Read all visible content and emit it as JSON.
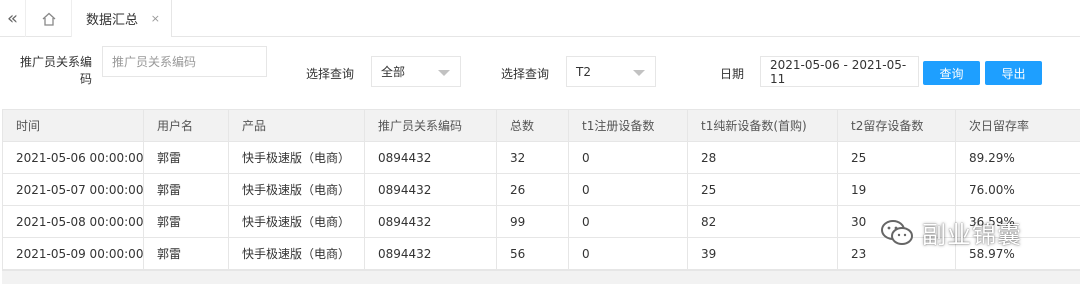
{
  "tabbar": {
    "collapse_glyph": "«",
    "home_icon": "home-icon",
    "active_tab": {
      "label": "数据汇总",
      "close": "×"
    }
  },
  "filters": {
    "relation_code": {
      "label": "推广员关系编码",
      "placeholder": "推广员关系编码",
      "value": ""
    },
    "query1": {
      "label": "选择查询",
      "selected": "全部"
    },
    "query2": {
      "label": "选择查询",
      "selected": "T2"
    },
    "date": {
      "label": "日期",
      "value": "2021-05-06 - 2021-05-11"
    },
    "buttons": {
      "search": "查询",
      "export": "导出"
    },
    "accent_color": "#1e9fff"
  },
  "table": {
    "columns": [
      "时间",
      "用户名",
      "产品",
      "推广员关系编码",
      "总数",
      "t1注册设备数",
      "t1纯新设备数(首购)",
      "t2留存设备数",
      "次日留存率"
    ],
    "rows": [
      [
        "2021-05-06 00:00:00",
        "郭雷",
        "快手极速版（电商）",
        "0894432",
        "32",
        "0",
        "28",
        "25",
        "89.29%"
      ],
      [
        "2021-05-07 00:00:00",
        "郭雷",
        "快手极速版（电商）",
        "0894432",
        "26",
        "0",
        "25",
        "19",
        "76.00%"
      ],
      [
        "2021-05-08 00:00:00",
        "郭雷",
        "快手极速版（电商）",
        "0894432",
        "99",
        "0",
        "82",
        "30",
        "36.59%"
      ],
      [
        "2021-05-09 00:00:00",
        "郭雷",
        "快手极速版（电商）",
        "0894432",
        "56",
        "0",
        "39",
        "23",
        "58.97%"
      ]
    ]
  },
  "watermark": {
    "text": "副业锦囊",
    "icon": "wechat-icon"
  }
}
